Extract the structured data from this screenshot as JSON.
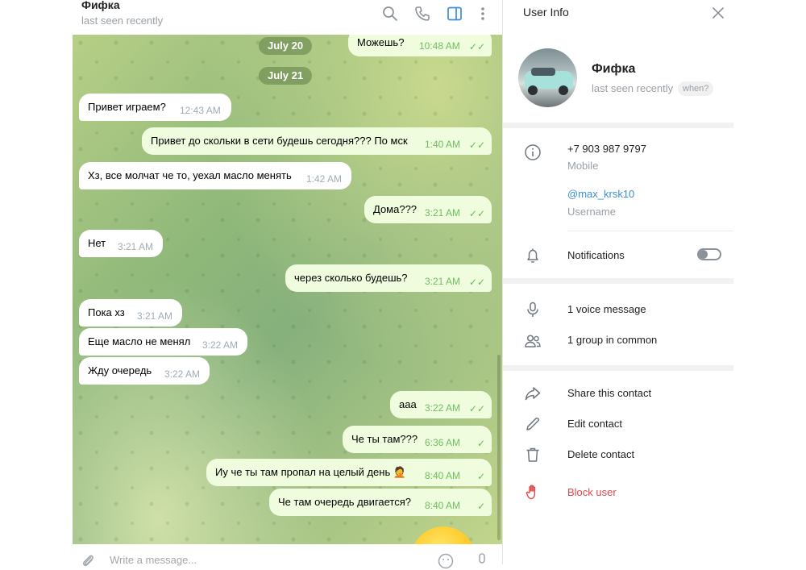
{
  "chat_header": {
    "title": "Фифка",
    "status": "last seen recently",
    "icons": [
      "search-icon",
      "phone-icon",
      "sidebar-toggle-icon",
      "more-vertical-icon"
    ]
  },
  "messages": [
    {
      "dir": "out",
      "text": "Можешь?",
      "time": "10:48 AM",
      "read": true
    },
    {
      "dir": "date",
      "text": "July 20"
    },
    {
      "dir": "date",
      "text": "July 21"
    },
    {
      "dir": "in",
      "text": "Привет играем?",
      "time": "12:43 AM"
    },
    {
      "dir": "out",
      "text": "Привет до скольки в сети будешь сегодня??? По мск",
      "time": "1:40 AM",
      "read": true
    },
    {
      "dir": "in",
      "text": "Хз, все молчат че то, уехал масло менять",
      "time": "1:42 AM"
    },
    {
      "dir": "out",
      "text": "Дома???",
      "time": "3:21 AM",
      "read": true
    },
    {
      "dir": "in",
      "text": "Нет",
      "time": "3:21 AM"
    },
    {
      "dir": "out",
      "text": "через сколько будешь?",
      "time": "3:21 AM",
      "read": true
    },
    {
      "dir": "in",
      "text": "Пока хз",
      "time": "3:21 AM"
    },
    {
      "dir": "in",
      "text": "Еще масло не менял",
      "time": "3:22 AM"
    },
    {
      "dir": "in",
      "text": "Жду очередь",
      "time": "3:22 AM"
    },
    {
      "dir": "out",
      "text": "ааа",
      "time": "3:22 AM",
      "read": true
    },
    {
      "dir": "out",
      "text": "Че ты там???",
      "time": "6:36 AM",
      "read": false
    },
    {
      "dir": "out",
      "text": "Иу че ты там пропал на целый день 🤦",
      "time": "8:40 AM",
      "read": false
    },
    {
      "dir": "out",
      "text": "Че там очередь двигается?",
      "time": "8:40 AM",
      "read": false
    }
  ],
  "input": {
    "placeholder": "Write a message..."
  },
  "user_info": {
    "panel_title": "User Info",
    "name": "Фифка",
    "last_seen": "last seen recently",
    "when_badge": "when?",
    "phone": "+7 903 987 9797",
    "phone_label": "Mobile",
    "username": "@max_krsk10",
    "username_label": "Username",
    "notifications_label": "Notifications",
    "notifications_enabled": false,
    "media": [
      {
        "icon": "microphone-icon",
        "label": "1 voice message"
      },
      {
        "icon": "group-icon",
        "label": "1 group in common"
      }
    ],
    "actions": [
      {
        "icon": "share-icon",
        "label": "Share this contact"
      },
      {
        "icon": "edit-icon",
        "label": "Edit contact"
      },
      {
        "icon": "trash-icon",
        "label": "Delete contact"
      },
      {
        "icon": "block-hand-icon",
        "label": "Block user"
      }
    ]
  },
  "colors": {
    "accent": "#3a8fd6",
    "danger": "#e0484b",
    "outgoing_bubble": "#effdde",
    "incoming_bubble": "#ffffff",
    "read_check": "#5fbf56"
  }
}
